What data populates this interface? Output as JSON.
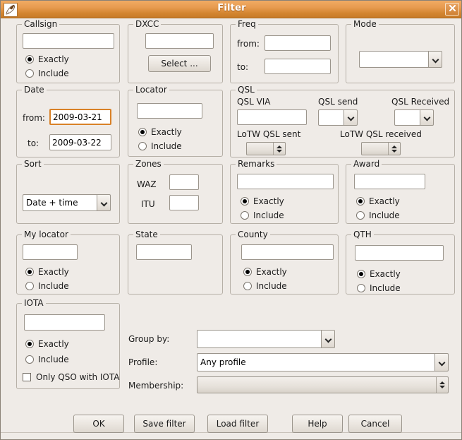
{
  "window": {
    "title": "Filter",
    "app_icon": "feather-icon",
    "close_label": "✕",
    "titlebar_color": "#d2842f",
    "background_color": "#efebe7",
    "focus_color": "#d98127"
  },
  "groups": {
    "callsign": {
      "legend": "Callsign",
      "value": "",
      "exactly_label": "Exactly",
      "include_label": "Include",
      "selected": "Exactly"
    },
    "dxcc": {
      "legend": "DXCC",
      "value": "",
      "select_button": "Select ..."
    },
    "freq": {
      "legend": "Freq",
      "from_label": "from:",
      "from_value": "",
      "to_label": "to:",
      "to_value": ""
    },
    "mode": {
      "legend": "Mode",
      "value": ""
    },
    "date": {
      "legend": "Date",
      "from_label": "from:",
      "from_value": "2009-03-21",
      "to_label": "to:",
      "to_value": "2009-03-22",
      "focused_field": "from"
    },
    "locator": {
      "legend": "Locator",
      "value": "",
      "exactly_label": "Exactly",
      "include_label": "Include",
      "selected": "Exactly"
    },
    "qsl": {
      "legend": "QSL",
      "via_label": "QSL VIA",
      "via_value": "",
      "send_label": "QSL send",
      "send_value": "",
      "received_label": "QSL Received",
      "received_value": "",
      "lotw_sent_label": "LoTW QSL sent",
      "lotw_sent_value": "",
      "lotw_received_label": "LoTW QSL received",
      "lotw_received_value": ""
    },
    "sort": {
      "legend": "Sort",
      "value": "Date + time"
    },
    "zones": {
      "legend": "Zones",
      "waz_label": "WAZ",
      "waz_value": "",
      "itu_label": "ITU",
      "itu_value": ""
    },
    "remarks": {
      "legend": "Remarks",
      "value": "",
      "exactly_label": "Exactly",
      "include_label": "Include",
      "selected": "Exactly"
    },
    "award": {
      "legend": "Award",
      "value": "",
      "exactly_label": "Exactly",
      "include_label": "Include",
      "selected": "Exactly"
    },
    "my_locator": {
      "legend": "My locator",
      "value": "",
      "exactly_label": "Exactly",
      "include_label": "Include",
      "selected": "Exactly"
    },
    "state": {
      "legend": "State",
      "value": ""
    },
    "county": {
      "legend": "County",
      "value": "",
      "exactly_label": "Exactly",
      "include_label": "Include",
      "selected": "Exactly"
    },
    "qth": {
      "legend": "QTH",
      "value": "",
      "exactly_label": "Exactly",
      "include_label": "Include",
      "selected": "Exactly"
    },
    "iota": {
      "legend": "IOTA",
      "value": "",
      "exactly_label": "Exactly",
      "include_label": "Include",
      "selected": "Exactly",
      "only_qso_label": "Only QSO with IOTA",
      "only_qso_checked": false
    }
  },
  "bottom_form": {
    "group_by_label": "Group by:",
    "group_by_value": "",
    "profile_label": "Profile:",
    "profile_value": "Any profile",
    "membership_label": "Membership:",
    "membership_value": ""
  },
  "buttons": {
    "ok": "OK",
    "save_filter": "Save filter",
    "load_filter": "Load filter",
    "help": "Help",
    "cancel": "Cancel"
  }
}
